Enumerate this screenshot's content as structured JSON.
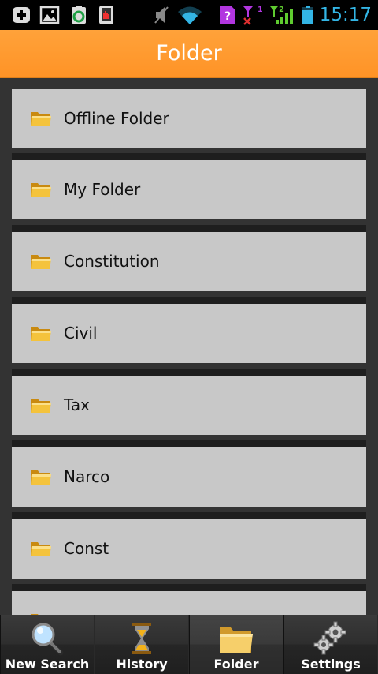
{
  "status_bar": {
    "time": "15:17",
    "icons": [
      "add-icon",
      "image-icon",
      "sync-icon",
      "screenshot-icon",
      "mute-icon",
      "wifi-icon",
      "sim-unknown-icon",
      "signal-sim1-icon",
      "signal-sim2-icon",
      "battery-icon"
    ],
    "sim_unknown_label": "?",
    "sim1_label": "1",
    "sim2_label": "2",
    "time_color": "#33b5e5"
  },
  "header": {
    "title": "Folder",
    "color": "#ff9a30"
  },
  "folders": [
    {
      "label": "Offline Folder"
    },
    {
      "label": "My Folder"
    },
    {
      "label": "Constitution"
    },
    {
      "label": "Civil"
    },
    {
      "label": "Tax"
    },
    {
      "label": "Narco"
    },
    {
      "label": "Const"
    },
    {
      "label": ""
    }
  ],
  "tabs": [
    {
      "label": "New Search",
      "icon": "magnifier-icon"
    },
    {
      "label": "History",
      "icon": "hourglass-icon"
    },
    {
      "label": "Folder",
      "icon": "folder-icon",
      "active": true
    },
    {
      "label": "Settings",
      "icon": "gears-icon"
    }
  ]
}
